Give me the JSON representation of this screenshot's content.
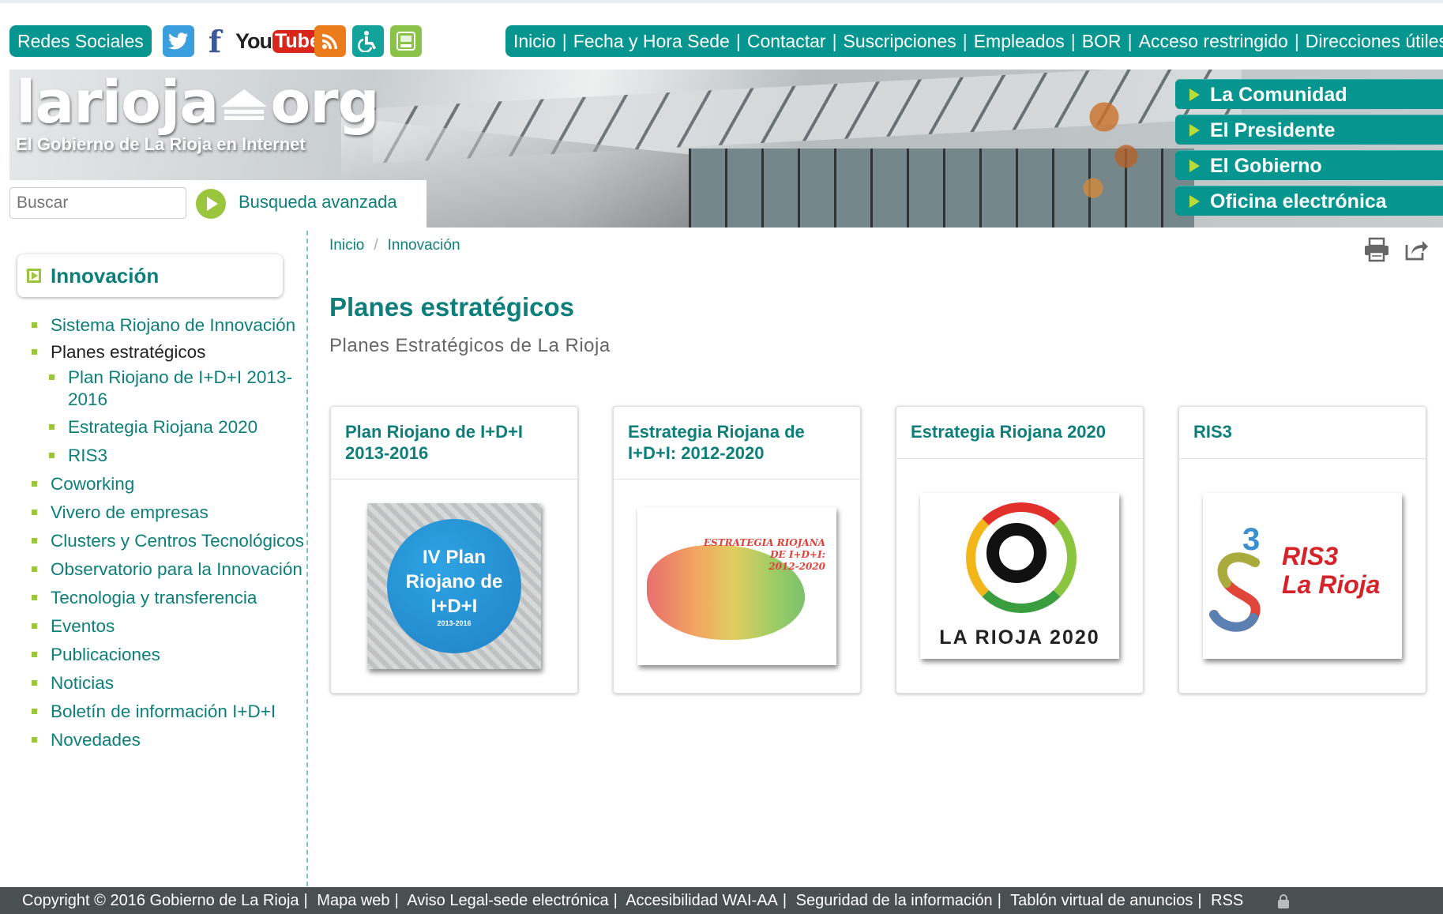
{
  "topbar": {
    "social_label": "Redes Sociales",
    "social_icons": {
      "twitter": "twitter-icon",
      "facebook_glyph": "f",
      "youtube_you": "You",
      "youtube_tube": "Tube",
      "rss": "rss-icon",
      "accessibility": "accessibility-icon",
      "app": "app-icon"
    },
    "nav": [
      "Inicio",
      "Fecha y Hora Sede",
      "Contactar",
      "Suscripciones",
      "Empleados",
      "BOR",
      "Acceso restringido",
      "Direcciones útiles"
    ]
  },
  "header": {
    "logo_name": "larioja",
    "logo_suffix": "org",
    "logo_tagline": "El Gobierno de La Rioja en Internet",
    "search_placeholder": "Buscar",
    "advanced_search": "Busqueda avanzada",
    "right_menu": [
      "La Comunidad",
      "El Presidente",
      "El Gobierno",
      "Oficina electrónica"
    ]
  },
  "sidebar": {
    "title": "Innovación",
    "items": [
      {
        "label": "Sistema Riojano de Innovación",
        "level": 1,
        "active": false
      },
      {
        "label": "Planes estratégicos",
        "level": 1,
        "active": true
      },
      {
        "label": "Plan Riojano de I+D+I 2013-2016",
        "level": 2,
        "active": false
      },
      {
        "label": "Estrategia Riojana 2020",
        "level": 2,
        "active": false
      },
      {
        "label": "RIS3",
        "level": 2,
        "active": false
      },
      {
        "label": "Coworking",
        "level": 1,
        "active": false
      },
      {
        "label": "Vivero de empresas",
        "level": 1,
        "active": false
      },
      {
        "label": "Clusters y Centros Tecnológicos",
        "level": 1,
        "active": false
      },
      {
        "label": "Observatorio para la Innovación",
        "level": 1,
        "active": false
      },
      {
        "label": "Tecnologia y transferencia",
        "level": 1,
        "active": false
      },
      {
        "label": "Eventos",
        "level": 1,
        "active": false
      },
      {
        "label": "Publicaciones",
        "level": 1,
        "active": false
      },
      {
        "label": "Noticias",
        "level": 1,
        "active": false
      },
      {
        "label": "Boletín de información I+D+I",
        "level": 1,
        "active": false
      },
      {
        "label": "Novedades",
        "level": 1,
        "active": false
      }
    ]
  },
  "main": {
    "breadcrumb": [
      "Inicio",
      "Innovación"
    ],
    "title": "Planes estratégicos",
    "subtitle": "Planes Estratégicos de La Rioja",
    "tools": {
      "print": "print-icon",
      "share": "share-icon"
    },
    "cards": [
      {
        "title_line1": "Plan Riojano de I+D+I",
        "title_line2": "2013-2016",
        "img_line1": "IV Plan",
        "img_line2": "Riojano de",
        "img_line3": "I+D+I",
        "img_year": "2013-2016"
      },
      {
        "title_line1": "Estrategia Riojana de",
        "title_line2": "I+D+I: 2012-2020",
        "img_line1": "ESTRATEGIA RIOJANA",
        "img_line2": "DE I+D+I:",
        "img_line3": "2012-2020"
      },
      {
        "title_line1": "Estrategia Riojana 2020",
        "title_line2": "",
        "img_text": "LA RIOJA 2020"
      },
      {
        "title_line1": "RIS3",
        "title_line2": "",
        "img_line1": "RIS3",
        "img_line2": "La Rioja",
        "img_digit": "3"
      }
    ]
  },
  "footer": {
    "copyright": "Copyright © 2016 Gobierno de La Rioja",
    "links": [
      "Mapa web",
      "Aviso Legal-sede electrónica",
      "Accesibilidad WAI-AA",
      "Seguridad de la información",
      "Tablón virtual de anuncios",
      "RSS"
    ]
  },
  "colors": {
    "accent": "#07968f",
    "accent_text": "#0c7f7a",
    "bullet": "#9bc53d",
    "footer_bg": "#4a4f52"
  }
}
